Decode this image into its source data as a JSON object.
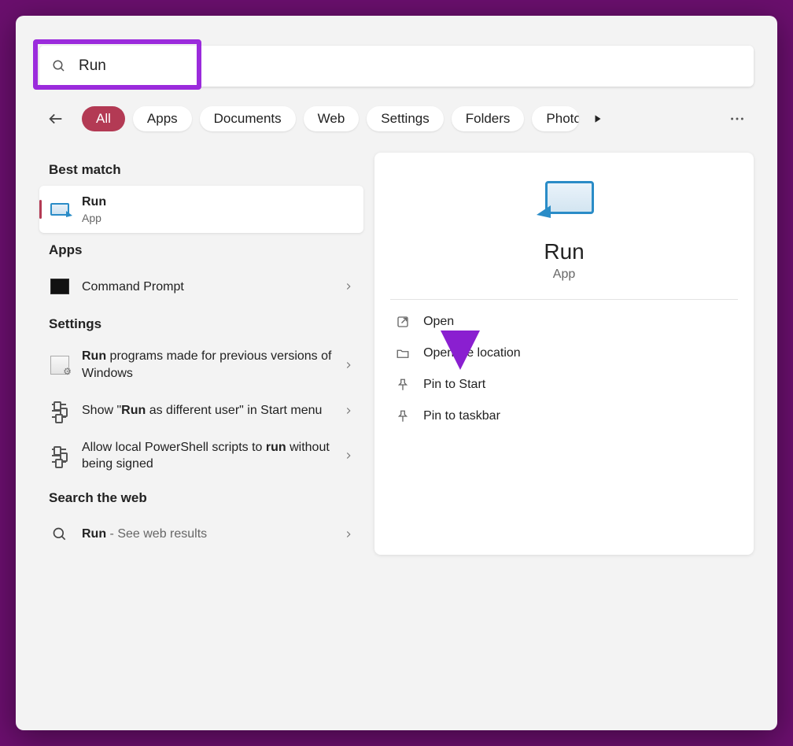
{
  "search": {
    "value": "Run"
  },
  "highlight_color": "#9b2bdc",
  "filters": {
    "active": "All",
    "items": [
      "All",
      "Apps",
      "Documents",
      "Web",
      "Settings",
      "Folders",
      "Photos"
    ]
  },
  "sections": {
    "best_match": {
      "header": "Best match",
      "item": {
        "title": "Run",
        "subtitle": "App"
      }
    },
    "apps": {
      "header": "Apps",
      "items": [
        {
          "title": "Command Prompt"
        }
      ]
    },
    "settings": {
      "header": "Settings",
      "items": [
        {
          "prefix_bold": "Run",
          "rest": " programs made for previous versions of Windows"
        },
        {
          "prefix": "Show \"",
          "mid_bold": "Run",
          "rest": " as different user\" in Start menu"
        },
        {
          "prefix": "Allow local PowerShell scripts to ",
          "mid_bold": "run",
          "rest": " without being signed"
        }
      ]
    },
    "web": {
      "header": "Search the web",
      "item": {
        "bold": "Run",
        "rest": " - See web results"
      }
    }
  },
  "preview": {
    "title": "Run",
    "subtitle": "App",
    "actions": [
      {
        "icon": "open-icon",
        "label": "Open"
      },
      {
        "icon": "folder-icon",
        "label": "Open file location"
      },
      {
        "icon": "pin-icon",
        "label": "Pin to Start"
      },
      {
        "icon": "pin-icon",
        "label": "Pin to taskbar"
      }
    ]
  }
}
